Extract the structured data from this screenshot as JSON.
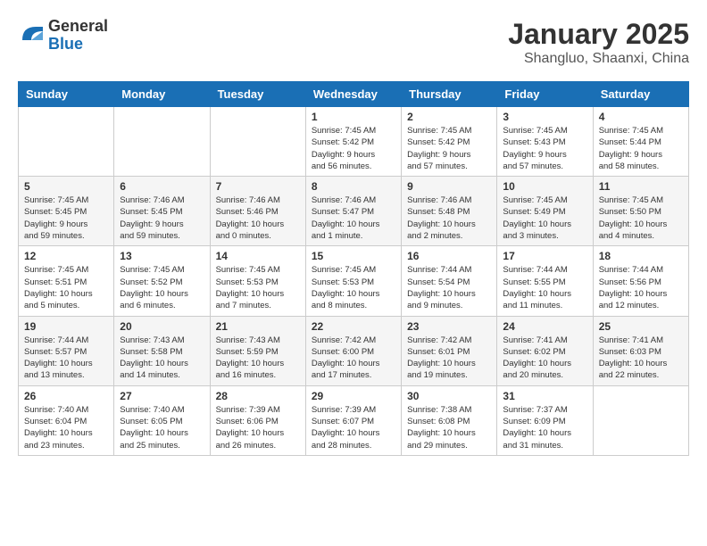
{
  "header": {
    "logo_general": "General",
    "logo_blue": "Blue",
    "month_year": "January 2025",
    "location": "Shangluo, Shaanxi, China"
  },
  "weekdays": [
    "Sunday",
    "Monday",
    "Tuesday",
    "Wednesday",
    "Thursday",
    "Friday",
    "Saturday"
  ],
  "weeks": [
    [
      {
        "day": "",
        "info": ""
      },
      {
        "day": "",
        "info": ""
      },
      {
        "day": "",
        "info": ""
      },
      {
        "day": "1",
        "info": "Sunrise: 7:45 AM\nSunset: 5:42 PM\nDaylight: 9 hours\nand 56 minutes."
      },
      {
        "day": "2",
        "info": "Sunrise: 7:45 AM\nSunset: 5:42 PM\nDaylight: 9 hours\nand 57 minutes."
      },
      {
        "day": "3",
        "info": "Sunrise: 7:45 AM\nSunset: 5:43 PM\nDaylight: 9 hours\nand 57 minutes."
      },
      {
        "day": "4",
        "info": "Sunrise: 7:45 AM\nSunset: 5:44 PM\nDaylight: 9 hours\nand 58 minutes."
      }
    ],
    [
      {
        "day": "5",
        "info": "Sunrise: 7:45 AM\nSunset: 5:45 PM\nDaylight: 9 hours\nand 59 minutes."
      },
      {
        "day": "6",
        "info": "Sunrise: 7:46 AM\nSunset: 5:45 PM\nDaylight: 9 hours\nand 59 minutes."
      },
      {
        "day": "7",
        "info": "Sunrise: 7:46 AM\nSunset: 5:46 PM\nDaylight: 10 hours\nand 0 minutes."
      },
      {
        "day": "8",
        "info": "Sunrise: 7:46 AM\nSunset: 5:47 PM\nDaylight: 10 hours\nand 1 minute."
      },
      {
        "day": "9",
        "info": "Sunrise: 7:46 AM\nSunset: 5:48 PM\nDaylight: 10 hours\nand 2 minutes."
      },
      {
        "day": "10",
        "info": "Sunrise: 7:45 AM\nSunset: 5:49 PM\nDaylight: 10 hours\nand 3 minutes."
      },
      {
        "day": "11",
        "info": "Sunrise: 7:45 AM\nSunset: 5:50 PM\nDaylight: 10 hours\nand 4 minutes."
      }
    ],
    [
      {
        "day": "12",
        "info": "Sunrise: 7:45 AM\nSunset: 5:51 PM\nDaylight: 10 hours\nand 5 minutes."
      },
      {
        "day": "13",
        "info": "Sunrise: 7:45 AM\nSunset: 5:52 PM\nDaylight: 10 hours\nand 6 minutes."
      },
      {
        "day": "14",
        "info": "Sunrise: 7:45 AM\nSunset: 5:53 PM\nDaylight: 10 hours\nand 7 minutes."
      },
      {
        "day": "15",
        "info": "Sunrise: 7:45 AM\nSunset: 5:53 PM\nDaylight: 10 hours\nand 8 minutes."
      },
      {
        "day": "16",
        "info": "Sunrise: 7:44 AM\nSunset: 5:54 PM\nDaylight: 10 hours\nand 9 minutes."
      },
      {
        "day": "17",
        "info": "Sunrise: 7:44 AM\nSunset: 5:55 PM\nDaylight: 10 hours\nand 11 minutes."
      },
      {
        "day": "18",
        "info": "Sunrise: 7:44 AM\nSunset: 5:56 PM\nDaylight: 10 hours\nand 12 minutes."
      }
    ],
    [
      {
        "day": "19",
        "info": "Sunrise: 7:44 AM\nSunset: 5:57 PM\nDaylight: 10 hours\nand 13 minutes."
      },
      {
        "day": "20",
        "info": "Sunrise: 7:43 AM\nSunset: 5:58 PM\nDaylight: 10 hours\nand 14 minutes."
      },
      {
        "day": "21",
        "info": "Sunrise: 7:43 AM\nSunset: 5:59 PM\nDaylight: 10 hours\nand 16 minutes."
      },
      {
        "day": "22",
        "info": "Sunrise: 7:42 AM\nSunset: 6:00 PM\nDaylight: 10 hours\nand 17 minutes."
      },
      {
        "day": "23",
        "info": "Sunrise: 7:42 AM\nSunset: 6:01 PM\nDaylight: 10 hours\nand 19 minutes."
      },
      {
        "day": "24",
        "info": "Sunrise: 7:41 AM\nSunset: 6:02 PM\nDaylight: 10 hours\nand 20 minutes."
      },
      {
        "day": "25",
        "info": "Sunrise: 7:41 AM\nSunset: 6:03 PM\nDaylight: 10 hours\nand 22 minutes."
      }
    ],
    [
      {
        "day": "26",
        "info": "Sunrise: 7:40 AM\nSunset: 6:04 PM\nDaylight: 10 hours\nand 23 minutes."
      },
      {
        "day": "27",
        "info": "Sunrise: 7:40 AM\nSunset: 6:05 PM\nDaylight: 10 hours\nand 25 minutes."
      },
      {
        "day": "28",
        "info": "Sunrise: 7:39 AM\nSunset: 6:06 PM\nDaylight: 10 hours\nand 26 minutes."
      },
      {
        "day": "29",
        "info": "Sunrise: 7:39 AM\nSunset: 6:07 PM\nDaylight: 10 hours\nand 28 minutes."
      },
      {
        "day": "30",
        "info": "Sunrise: 7:38 AM\nSunset: 6:08 PM\nDaylight: 10 hours\nand 29 minutes."
      },
      {
        "day": "31",
        "info": "Sunrise: 7:37 AM\nSunset: 6:09 PM\nDaylight: 10 hours\nand 31 minutes."
      },
      {
        "day": "",
        "info": ""
      }
    ]
  ]
}
